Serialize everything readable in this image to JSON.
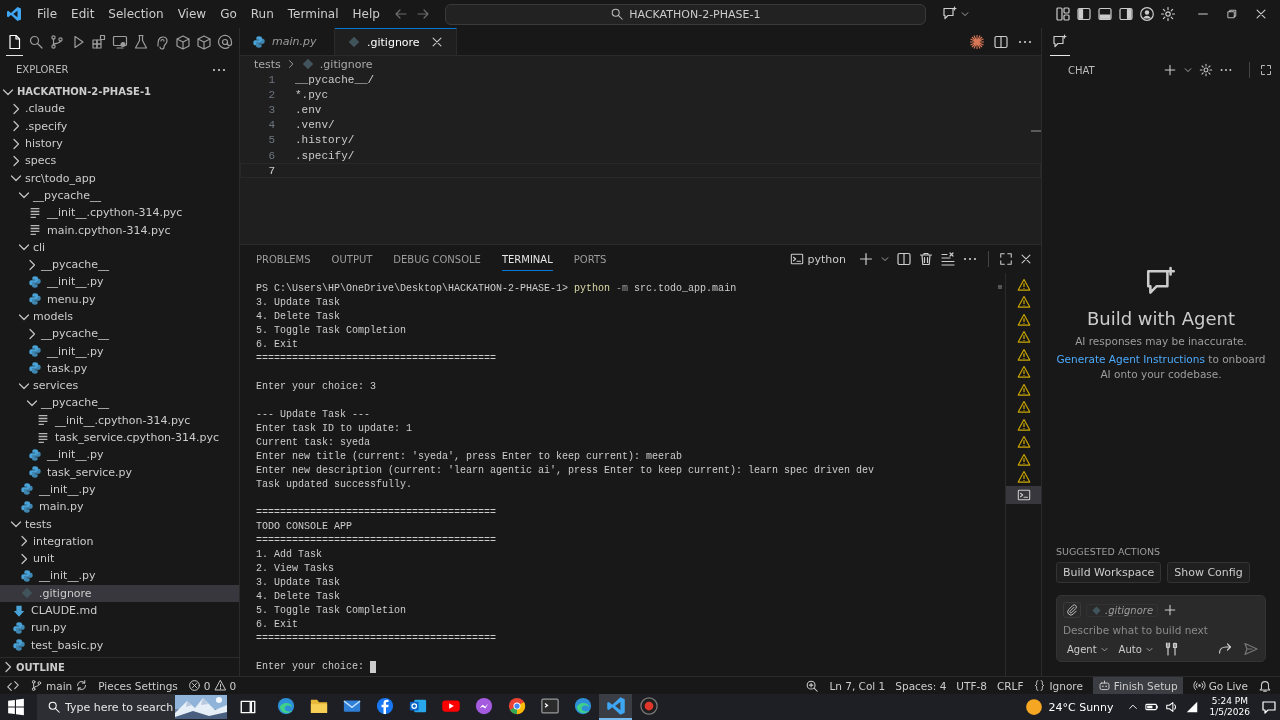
{
  "window": {
    "title": "HACKATHON-2-PHASE-1"
  },
  "menu": [
    "File",
    "Edit",
    "Selection",
    "View",
    "Go",
    "Run",
    "Terminal",
    "Help"
  ],
  "activity": [
    {
      "kind": "explorer",
      "selected": true
    },
    {
      "kind": "search",
      "selected": false
    },
    {
      "kind": "source-control",
      "selected": false
    },
    {
      "kind": "run",
      "selected": false
    },
    {
      "kind": "extensions",
      "selected": false
    },
    {
      "kind": "remote",
      "selected": false
    },
    {
      "kind": "testing",
      "selected": false
    },
    {
      "kind": "pieces",
      "selected": false
    },
    {
      "kind": "package",
      "selected": false
    },
    {
      "kind": "package",
      "selected": false
    },
    {
      "kind": "account",
      "selected": false
    }
  ],
  "explorer": {
    "title": "EXPLORER",
    "workspace": {
      "name": "HACKATHON-2-PHASE-1",
      "expanded": true
    },
    "tree": [
      {
        "name": ".claude",
        "kind": "folder",
        "expanded": false,
        "selected": false
      },
      {
        "name": ".specify",
        "kind": "folder",
        "expanded": false,
        "selected": false
      },
      {
        "name": "history",
        "kind": "folder",
        "expanded": false,
        "selected": false
      },
      {
        "name": "specs",
        "kind": "folder",
        "expanded": false,
        "selected": false
      },
      {
        "name": "src\\todo_app",
        "kind": "folder",
        "expanded": true,
        "selected": false,
        "children": [
          {
            "name": "__pycache__",
            "kind": "folder",
            "expanded": true,
            "selected": false,
            "children": [
              {
                "name": "__init__.cpython-314.pyc",
                "kind": "bytecode",
                "selected": false
              },
              {
                "name": "main.cpython-314.pyc",
                "kind": "bytecode",
                "selected": false
              }
            ]
          },
          {
            "name": "cli",
            "kind": "folder",
            "expanded": true,
            "selected": false,
            "children": [
              {
                "name": "__pycache__",
                "kind": "folder",
                "expanded": false,
                "selected": false
              },
              {
                "name": "__init__.py",
                "kind": "python",
                "selected": false
              },
              {
                "name": "menu.py",
                "kind": "python",
                "selected": false
              }
            ]
          },
          {
            "name": "models",
            "kind": "folder",
            "expanded": true,
            "selected": false,
            "children": [
              {
                "name": "__pycache__",
                "kind": "folder",
                "expanded": false,
                "selected": false
              },
              {
                "name": "__init__.py",
                "kind": "python",
                "selected": false
              },
              {
                "name": "task.py",
                "kind": "python",
                "selected": false
              }
            ]
          },
          {
            "name": "services",
            "kind": "folder",
            "expanded": true,
            "selected": false,
            "children": [
              {
                "name": "__pycache__",
                "kind": "folder",
                "expanded": true,
                "selected": false,
                "children": [
                  {
                    "name": "__init__.cpython-314.pyc",
                    "kind": "bytecode",
                    "selected": false
                  },
                  {
                    "name": "task_service.cpython-314.pyc",
                    "kind": "bytecode",
                    "selected": false
                  }
                ]
              },
              {
                "name": "__init__.py",
                "kind": "python",
                "selected": false
              },
              {
                "name": "task_service.py",
                "kind": "python",
                "selected": false
              }
            ]
          },
          {
            "name": "__init__.py",
            "kind": "python",
            "selected": false
          },
          {
            "name": "main.py",
            "kind": "python",
            "selected": false
          }
        ]
      },
      {
        "name": "tests",
        "kind": "folder",
        "expanded": true,
        "selected": false,
        "children": [
          {
            "name": "integration",
            "kind": "folder",
            "expanded": false,
            "selected": false
          },
          {
            "name": "unit",
            "kind": "folder",
            "expanded": false,
            "selected": false
          },
          {
            "name": "__init__.py",
            "kind": "python",
            "selected": false
          },
          {
            "name": ".gitignore",
            "kind": "ignore",
            "selected": true
          }
        ]
      },
      {
        "name": "CLAUDE.md",
        "kind": "markdown",
        "selected": false
      },
      {
        "name": "run.py",
        "kind": "python",
        "selected": false
      },
      {
        "name": "test_basic.py",
        "kind": "python",
        "selected": false
      }
    ]
  },
  "outline": {
    "title": "OUTLINE",
    "expanded": false
  },
  "editor_tabs": [
    {
      "label": "main.py",
      "kind": "python",
      "preview": true,
      "selected": false
    },
    {
      "label": ".gitignore",
      "kind": "ignore",
      "preview": false,
      "selected": true
    }
  ],
  "breadcrumb": [
    {
      "label": "tests",
      "kind": "folder"
    },
    {
      "label": ".gitignore",
      "kind": "ignore"
    }
  ],
  "code_lines": [
    {
      "number": "1",
      "text": "__pycache__/",
      "current": false
    },
    {
      "number": "2",
      "text": "*.pyc",
      "current": false
    },
    {
      "number": "3",
      "text": ".env",
      "current": false
    },
    {
      "number": "4",
      "text": ".venv/",
      "current": false
    },
    {
      "number": "5",
      "text": ".history/",
      "current": false
    },
    {
      "number": "6",
      "text": ".specify/",
      "current": false
    },
    {
      "number": "7",
      "current": true
    }
  ],
  "panel": {
    "tabs": [
      {
        "label": "PROBLEMS",
        "selected": false
      },
      {
        "label": "OUTPUT",
        "selected": false
      },
      {
        "label": "DEBUG CONSOLE",
        "selected": false
      },
      {
        "label": "TERMINAL",
        "selected": true
      },
      {
        "label": "PORTS",
        "selected": false
      }
    ],
    "terminal_name": "python",
    "prompt": "PS C:\\Users\\HP\\OneDrive\\Desktop\\HACKATHON-2-PHASE-1>",
    "command": "python",
    "flag": "-m",
    "target": "src.todo_app.main",
    "blocks": [
      [
        "3. Update Task",
        "4. Delete Task",
        "5. Toggle Task Completion",
        "6. Exit",
        "========================================"
      ],
      [
        "Enter your choice: 3"
      ],
      [
        "--- Update Task ---",
        "Enter task ID to update: 1",
        "Current task: syeda",
        "Enter new title (current: 'syeda', press Enter to keep current): meerab",
        "Enter new description (current: 'learn agentic ai', press Enter to keep current): learn spec driven dev",
        "Task updated successfully."
      ],
      [
        "========================================",
        "TODO CONSOLE APP",
        "========================================",
        "1. Add Task",
        "2. View Tasks",
        "3. Update Task",
        "4. Delete Task",
        "5. Toggle Task Completion",
        "6. Exit",
        "========================================"
      ]
    ],
    "input_prompt": "Enter your choice:",
    "sessions": [
      {
        "kind": "warning",
        "selected": false
      },
      {
        "kind": "warning",
        "selected": false
      },
      {
        "kind": "warning",
        "selected": false
      },
      {
        "kind": "warning",
        "selected": false
      },
      {
        "kind": "warning",
        "selected": false
      },
      {
        "kind": "warning",
        "selected": false
      },
      {
        "kind": "warning",
        "selected": false
      },
      {
        "kind": "warning",
        "selected": false
      },
      {
        "kind": "warning",
        "selected": false
      },
      {
        "kind": "warning",
        "selected": false
      },
      {
        "kind": "warning",
        "selected": false
      },
      {
        "kind": "warning",
        "selected": false
      },
      {
        "kind": "shell",
        "selected": true
      }
    ]
  },
  "chat": {
    "title": "CHAT",
    "heading": "Build with Agent",
    "disclaimer": "AI responses may be inaccurate.",
    "link": "Generate Agent Instructions",
    "link_rest": "to onboard AI onto your codebase.",
    "suggested_title": "SUGGESTED ACTIONS",
    "suggestions": [
      "Build Workspace",
      "Show Config"
    ],
    "context_file": ".gitignore",
    "placeholder": "Describe what to build next",
    "mode": "Agent",
    "model": "Auto"
  },
  "status_bar": {
    "branch": "main",
    "pieces": "Pieces Settings",
    "errors": "0",
    "warnings": "0",
    "position": "Ln 7, Col 1",
    "indent": "Spaces: 4",
    "encoding": "UTF-8",
    "eol": "CRLF",
    "language": "Ignore",
    "setup": "Finish Setup",
    "live": "Go Live"
  },
  "taskbar": {
    "search_placeholder": "Type here to search",
    "apps": [
      {
        "kind": "edge",
        "selected": false
      },
      {
        "kind": "files",
        "selected": false
      },
      {
        "kind": "mail",
        "selected": false
      },
      {
        "kind": "facebook",
        "selected": false
      },
      {
        "kind": "outlook",
        "selected": false
      },
      {
        "kind": "youtube",
        "selected": false
      },
      {
        "kind": "messenger",
        "selected": false
      },
      {
        "kind": "chrome",
        "selected": false
      },
      {
        "kind": "terminal",
        "selected": false
      },
      {
        "kind": "edge",
        "selected": false
      },
      {
        "kind": "vscode",
        "selected": true
      },
      {
        "kind": "recorder",
        "selected": false
      }
    ],
    "weather": "24°C Sunny",
    "time": "5:24 PM",
    "date": "1/5/2026"
  }
}
